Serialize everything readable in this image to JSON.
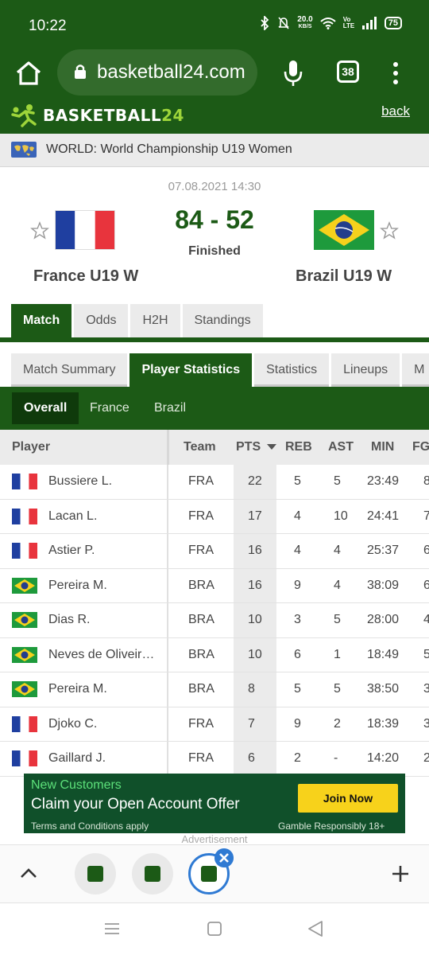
{
  "status_bar": {
    "time": "10:22",
    "speed_value": "20.0",
    "speed_unit": "KB/S",
    "volte": "Vo LTE",
    "battery": "75"
  },
  "browser": {
    "url": "basketball24.com",
    "tab_count": "38"
  },
  "site": {
    "logo_text": "BASKETBALL",
    "logo_num": "24",
    "back_label": "back"
  },
  "competition": "WORLD: World Championship U19 Women",
  "match": {
    "date": "07.08.2021 14:30",
    "score": "84 - 52",
    "status": "Finished",
    "home": {
      "name": "France U19 W",
      "code": "FRA"
    },
    "away": {
      "name": "Brazil U19 W",
      "code": "BRA"
    }
  },
  "main_tabs": [
    "Match",
    "Odds",
    "H2H",
    "Standings"
  ],
  "sub_tabs": [
    "Match Summary",
    "Player Statistics",
    "Statistics",
    "Lineups",
    "M"
  ],
  "filters": [
    "Overall",
    "France",
    "Brazil"
  ],
  "table": {
    "headers": [
      "Player",
      "Team",
      "PTS",
      "REB",
      "AST",
      "MIN",
      "FG"
    ],
    "rows": [
      {
        "flag": "fr",
        "name": "Bussiere L.",
        "team": "FRA",
        "pts": "22",
        "reb": "5",
        "ast": "5",
        "min": "23:49",
        "fg": "8"
      },
      {
        "flag": "fr",
        "name": "Lacan L.",
        "team": "FRA",
        "pts": "17",
        "reb": "4",
        "ast": "10",
        "min": "24:41",
        "fg": "7"
      },
      {
        "flag": "fr",
        "name": "Astier P.",
        "team": "FRA",
        "pts": "16",
        "reb": "4",
        "ast": "4",
        "min": "25:37",
        "fg": "6"
      },
      {
        "flag": "br",
        "name": "Pereira M.",
        "team": "BRA",
        "pts": "16",
        "reb": "9",
        "ast": "4",
        "min": "38:09",
        "fg": "6"
      },
      {
        "flag": "br",
        "name": "Dias R.",
        "team": "BRA",
        "pts": "10",
        "reb": "3",
        "ast": "5",
        "min": "28:00",
        "fg": "4"
      },
      {
        "flag": "br",
        "name": "Neves de Oliveir…",
        "team": "BRA",
        "pts": "10",
        "reb": "6",
        "ast": "1",
        "min": "18:49",
        "fg": "5"
      },
      {
        "flag": "br",
        "name": "Pereira M.",
        "team": "BRA",
        "pts": "8",
        "reb": "5",
        "ast": "5",
        "min": "38:50",
        "fg": "3"
      },
      {
        "flag": "fr",
        "name": "Djoko C.",
        "team": "FRA",
        "pts": "7",
        "reb": "9",
        "ast": "2",
        "min": "18:39",
        "fg": "3"
      },
      {
        "flag": "fr",
        "name": "Gaillard J.",
        "team": "FRA",
        "pts": "6",
        "reb": "2",
        "ast": "-",
        "min": "14:20",
        "fg": "2"
      }
    ]
  },
  "ad": {
    "line1": "New Customers",
    "line2": "Claim your Open Account Offer",
    "terms": "Terms and Conditions apply",
    "button": "Join Now",
    "responsible": "Gamble Responsibly 18+",
    "label": "Advertisement"
  },
  "colors": {
    "brand_green": "#1c5a16",
    "accent_blue": "#2f7ad3",
    "ad_yellow": "#f7d21b"
  }
}
